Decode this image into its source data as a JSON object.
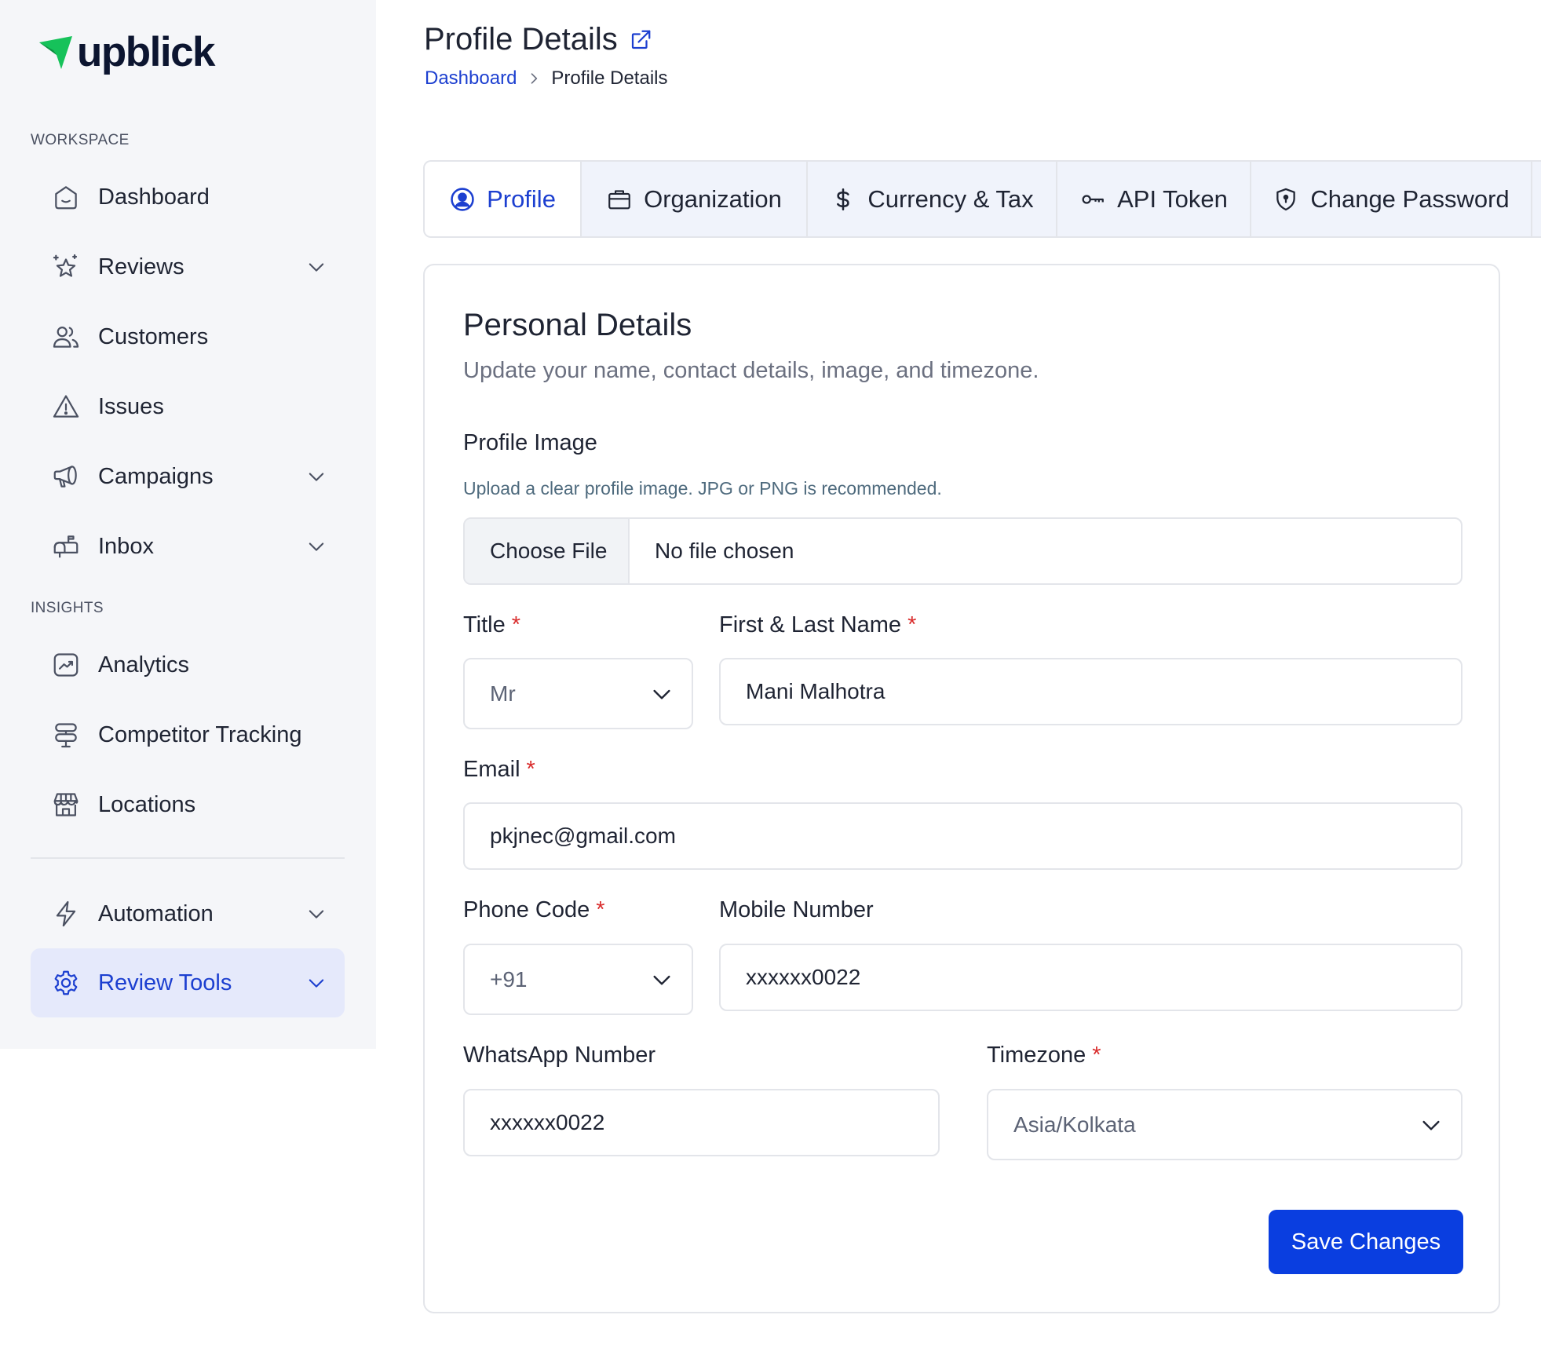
{
  "brand": {
    "name": "upblick",
    "accent": "#1c3fd0",
    "logo_green": "#16c25a"
  },
  "sidebar": {
    "sections": [
      {
        "label": "WORKSPACE"
      },
      {
        "label": "INSIGHTS"
      }
    ],
    "items": [
      {
        "label": "Dashboard",
        "icon": "home-icon",
        "has_chevron": false
      },
      {
        "label": "Reviews",
        "icon": "star-sparkle-icon",
        "has_chevron": true
      },
      {
        "label": "Customers",
        "icon": "users-icon",
        "has_chevron": false
      },
      {
        "label": "Issues",
        "icon": "warning-icon",
        "has_chevron": false
      },
      {
        "label": "Campaigns",
        "icon": "megaphone-icon",
        "has_chevron": true
      },
      {
        "label": "Inbox",
        "icon": "mailbox-icon",
        "has_chevron": true
      },
      {
        "label": "Analytics",
        "icon": "chart-icon",
        "has_chevron": false
      },
      {
        "label": "Competitor Tracking",
        "icon": "signpost-icon",
        "has_chevron": false
      },
      {
        "label": "Locations",
        "icon": "store-icon",
        "has_chevron": false
      },
      {
        "label": "Automation",
        "icon": "bolt-icon",
        "has_chevron": true
      },
      {
        "label": "Review Tools",
        "icon": "gear-icon",
        "has_chevron": true,
        "active": true
      }
    ]
  },
  "header": {
    "title": "Profile Details",
    "breadcrumb": {
      "parent": "Dashboard",
      "current": "Profile Details"
    }
  },
  "tabs": [
    {
      "label": "Profile",
      "icon": "user-circle-icon",
      "active": true
    },
    {
      "label": "Organization",
      "icon": "briefcase-icon"
    },
    {
      "label": "Currency & Tax",
      "icon": "dollar-icon"
    },
    {
      "label": "API Token",
      "icon": "key-icon"
    },
    {
      "label": "Change Password",
      "icon": "shield-icon"
    }
  ],
  "form": {
    "title": "Personal Details",
    "subtitle": "Update your name, contact details, image, and timezone.",
    "profile_image": {
      "label": "Profile Image",
      "hint": "Upload a clear profile image. JPG or PNG is recommended.",
      "button": "Choose File",
      "status": "No file chosen"
    },
    "title_field": {
      "label": "Title",
      "required_mark": "*",
      "value": "Mr"
    },
    "name_field": {
      "label": "First & Last Name",
      "required_mark": "*",
      "value": "Mani Malhotra"
    },
    "email_field": {
      "label": "Email",
      "required_mark": "*",
      "value": "pkjnec@gmail.com"
    },
    "phone_code_field": {
      "label": "Phone Code",
      "required_mark": "*",
      "value": "+91"
    },
    "mobile_field": {
      "label": "Mobile Number",
      "value": "xxxxxx0022"
    },
    "whatsapp_field": {
      "label": "WhatsApp Number",
      "value": "xxxxxx0022"
    },
    "timezone_field": {
      "label": "Timezone",
      "required_mark": "*",
      "value": "Asia/Kolkata"
    },
    "save_label": "Save Changes"
  }
}
